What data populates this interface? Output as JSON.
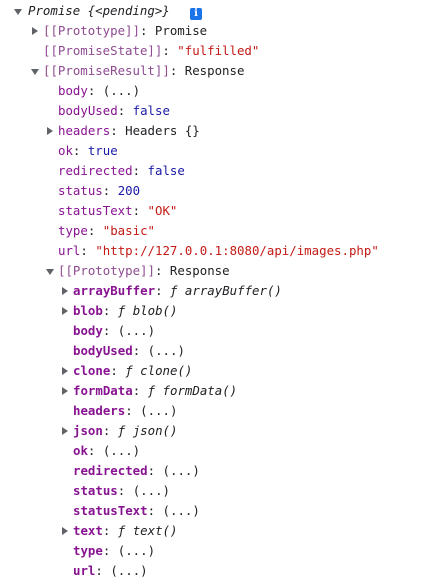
{
  "root": {
    "label": "Promise {<pending>}",
    "info_icon": "i"
  },
  "prototype_row": {
    "key": "[[Prototype]]",
    "sep": ": ",
    "value": "Promise"
  },
  "state_row": {
    "key": "[[PromiseState]]",
    "sep": ": ",
    "value": "\"fulfilled\""
  },
  "result_row": {
    "key": "[[PromiseResult]]",
    "sep": ": ",
    "value": "Response"
  },
  "props": [
    {
      "key": "body",
      "sep": ": ",
      "value": "(...)"
    },
    {
      "key": "bodyUsed",
      "sep": ": ",
      "value": "false"
    },
    {
      "key": "headers",
      "sep": ": ",
      "value": "Headers {}"
    },
    {
      "key": "ok",
      "sep": ": ",
      "value": "true"
    },
    {
      "key": "redirected",
      "sep": ": ",
      "value": "false"
    },
    {
      "key": "status",
      "sep": ": ",
      "value": "200"
    },
    {
      "key": "statusText",
      "sep": ": ",
      "value": "\"OK\""
    },
    {
      "key": "type",
      "sep": ": ",
      "value": "\"basic\""
    },
    {
      "key": "url",
      "sep": ": ",
      "value": "\"http://127.0.0.1:8080/api/images.php\""
    }
  ],
  "proto_row": {
    "key": "[[Prototype]]",
    "sep": ": ",
    "value": "Response"
  },
  "proto_props": [
    {
      "key": "arrayBuffer",
      "sep": ": ",
      "f": "ƒ",
      "value": " arrayBuffer()"
    },
    {
      "key": "blob",
      "sep": ": ",
      "f": "ƒ",
      "value": " blob()"
    },
    {
      "key": "body",
      "sep": ": ",
      "value": "(...)"
    },
    {
      "key": "bodyUsed",
      "sep": ": ",
      "value": "(...)"
    },
    {
      "key": "clone",
      "sep": ": ",
      "f": "ƒ",
      "value": " clone()"
    },
    {
      "key": "formData",
      "sep": ": ",
      "f": "ƒ",
      "value": " formData()"
    },
    {
      "key": "headers",
      "sep": ": ",
      "value": "(...)"
    },
    {
      "key": "json",
      "sep": ": ",
      "f": "ƒ",
      "value": " json()"
    },
    {
      "key": "ok",
      "sep": ": ",
      "value": "(...)"
    },
    {
      "key": "redirected",
      "sep": ": ",
      "value": "(...)"
    },
    {
      "key": "status",
      "sep": ": ",
      "value": "(...)"
    },
    {
      "key": "statusText",
      "sep": ": ",
      "value": "(...)"
    },
    {
      "key": "text",
      "sep": ": ",
      "f": "ƒ",
      "value": " text()"
    },
    {
      "key": "type",
      "sep": ": ",
      "value": "(...)"
    },
    {
      "key": "url",
      "sep": ": ",
      "value": "(...)"
    }
  ]
}
